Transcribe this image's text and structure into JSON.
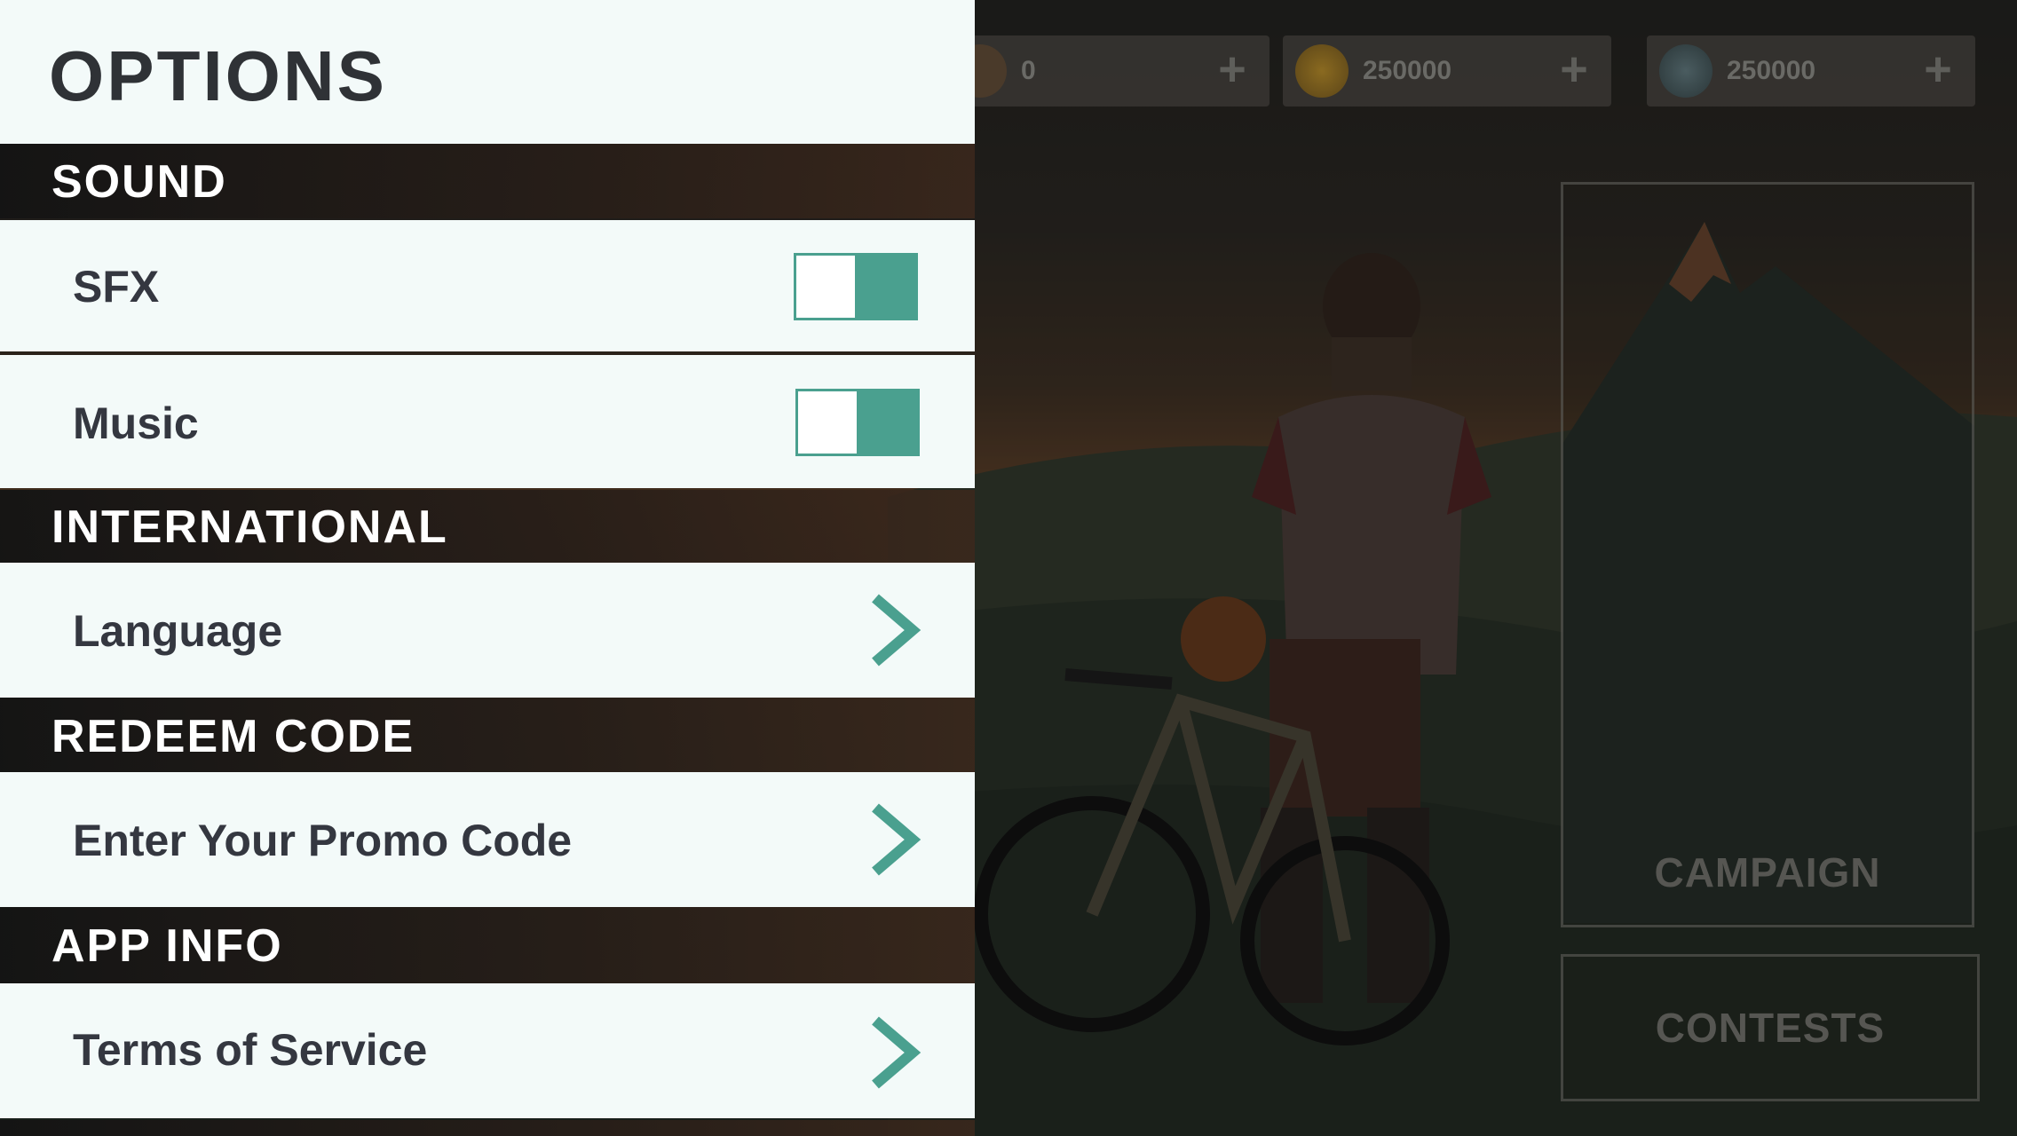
{
  "options": {
    "title": "OPTIONS",
    "sections": {
      "sound": "SOUND",
      "international": "INTERNATIONAL",
      "redeem": "REDEEM CODE",
      "app_info": "APP INFO"
    },
    "rows": {
      "sfx": "SFX",
      "music": "Music",
      "language": "Language",
      "promo": "Enter Your Promo Code",
      "terms": "Terms of Service"
    },
    "toggles": {
      "sfx_on": true,
      "music_on": true
    }
  },
  "background": {
    "currencies": [
      {
        "icon": "ticket-icon",
        "amount": "0"
      },
      {
        "icon": "gold-coin-icon",
        "amount": "250000"
      },
      {
        "icon": "gem-icon",
        "amount": "250000"
      }
    ],
    "modes": {
      "campaign": "CAMPAIGN",
      "contests": "CONTESTS"
    }
  },
  "colors": {
    "accent": "#4aa08f",
    "row_bg": "#f3faf9",
    "section_bg": "#141414",
    "text_dark": "#343740"
  }
}
